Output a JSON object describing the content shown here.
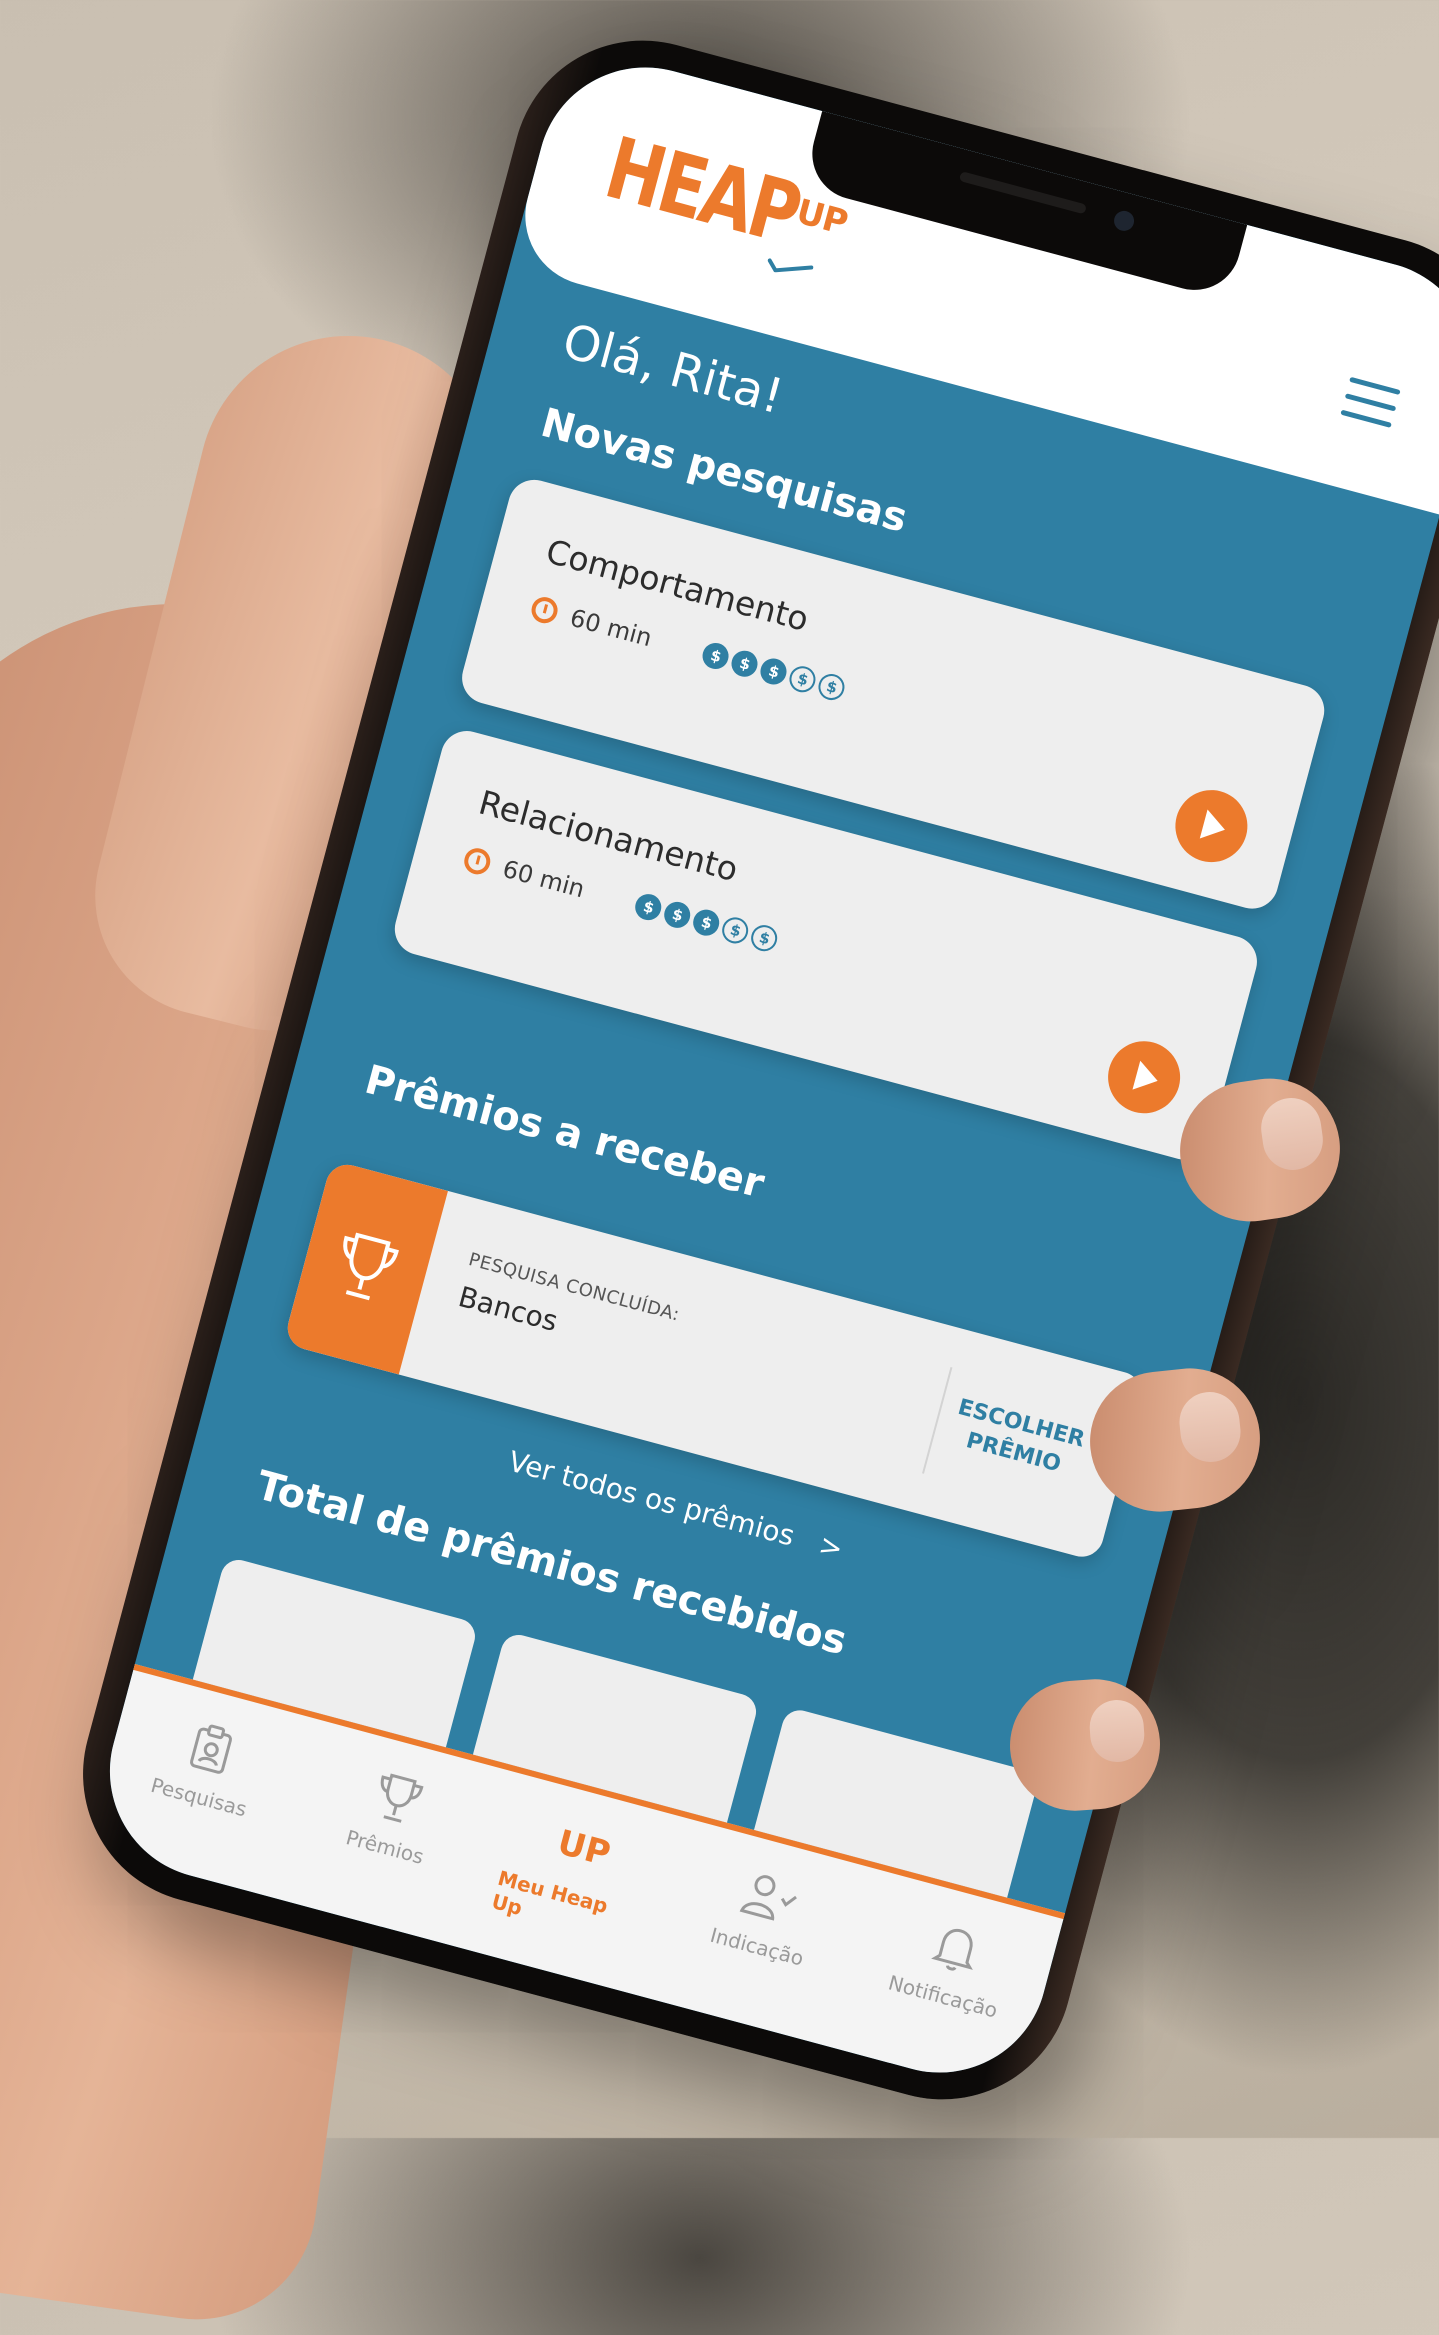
{
  "app": {
    "logo_main": "HEAP",
    "logo_sub": "UP"
  },
  "home": {
    "greeting": "Olá, Rita!",
    "new_surveys_title": "Novas pesquisas",
    "surveys": [
      {
        "title": "Comportamento",
        "duration": "60 min",
        "coins_filled": 3,
        "coins_total": 5
      },
      {
        "title": "Relacionamento",
        "duration": "60 min",
        "coins_filled": 3,
        "coins_total": 5
      }
    ],
    "prizes_title": "Prêmios a receber",
    "prize": {
      "label": "PESQUISA CONCLUÍDA:",
      "name": "Bancos",
      "action_line1": "ESCOLHER",
      "action_line2": "PRÊMIO"
    },
    "see_all": "Ver todos os prêmios",
    "see_all_chevron": ">",
    "total_title": "Total de prêmios recebidos"
  },
  "tabbar": {
    "items": [
      {
        "label": "Pesquisas",
        "icon": "clipboard-icon",
        "active": false
      },
      {
        "label": "Prêmios",
        "icon": "trophy-icon",
        "active": false
      },
      {
        "label": "Meu Heap Up",
        "icon": "heapup-icon",
        "active": true
      },
      {
        "label": "Indicação",
        "icon": "user-check-icon",
        "active": false
      },
      {
        "label": "Notificação",
        "icon": "bell-icon",
        "active": false
      }
    ],
    "meu_icon_text": "UP"
  },
  "colors": {
    "primary_blue": "#2f7fa3",
    "accent_orange": "#ec7a2c",
    "card_bg": "#eeeeee"
  }
}
